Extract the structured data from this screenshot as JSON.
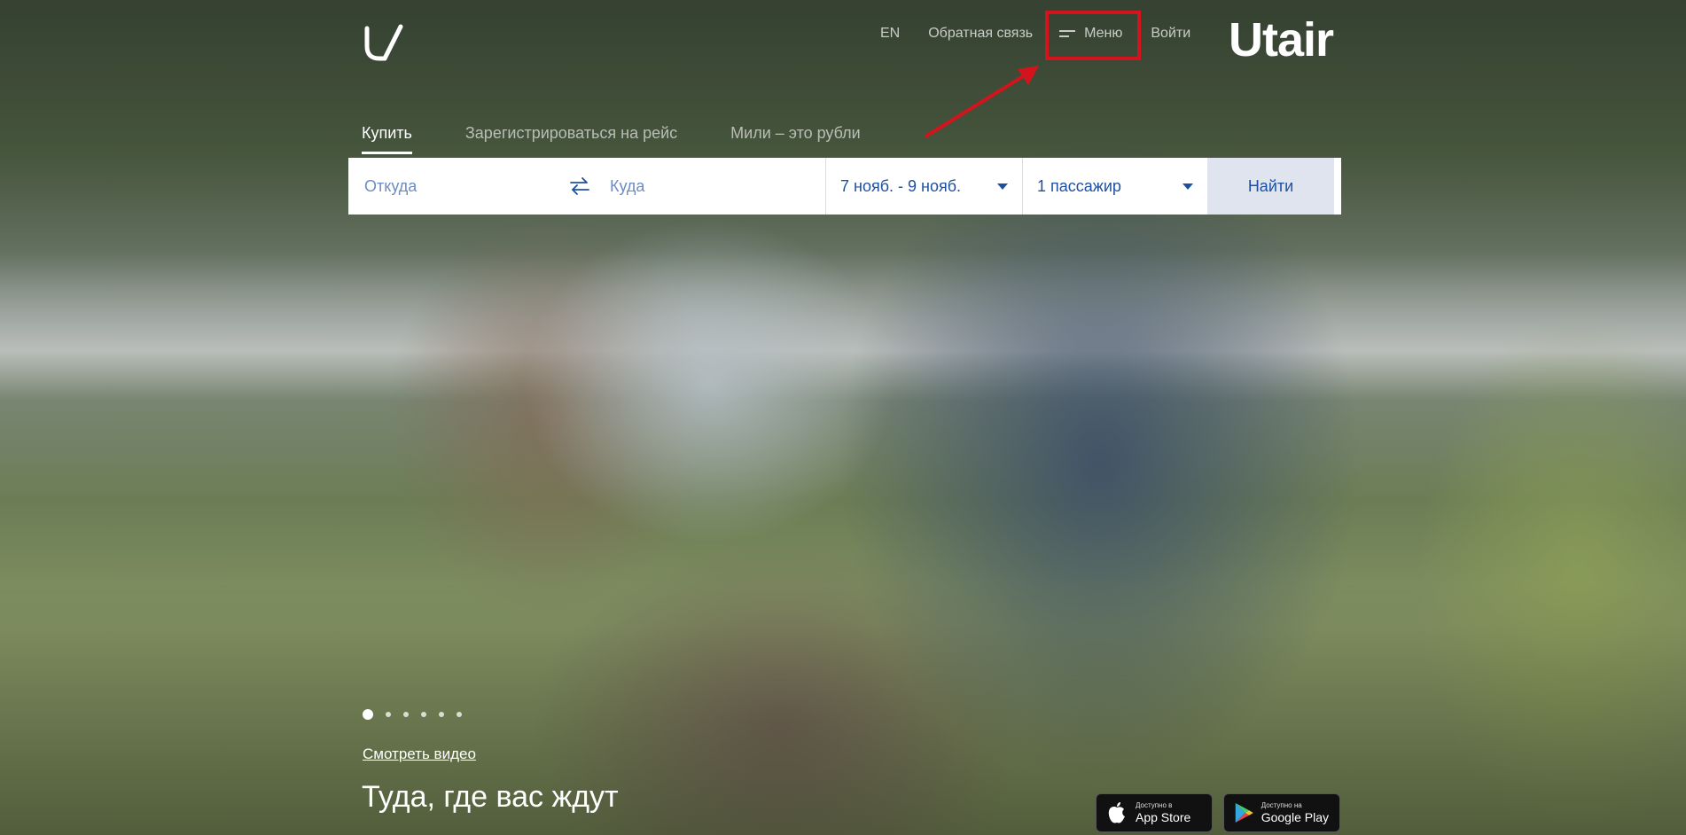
{
  "header": {
    "brand": "Utair",
    "nav": {
      "lang": "EN",
      "feedback": "Обратная связь",
      "menu": "Меню",
      "login": "Войти"
    }
  },
  "tabs": [
    {
      "label": "Купить",
      "active": true
    },
    {
      "label": "Зарегистрироваться на рейс",
      "active": false
    },
    {
      "label": "Мили – это рубли",
      "active": false
    }
  ],
  "search": {
    "from_placeholder": "Откуда",
    "to_placeholder": "Куда",
    "dates": "7 нояб. - 9 нояб.",
    "passengers": "1 пассажир",
    "submit": "Найти"
  },
  "hero": {
    "slides_count": 6,
    "active_slide": 1,
    "watch_video": "Смотреть видео",
    "tagline": "Туда, где вас ждут"
  },
  "stores": {
    "appstore_small": "Доступно в",
    "appstore_big": "App Store",
    "gplay_small": "Доступно на",
    "gplay_big": "Google Play"
  },
  "colors": {
    "highlight": "#d4141c",
    "field_text": "#1e50a0",
    "button_bg": "#dfe4ef"
  }
}
